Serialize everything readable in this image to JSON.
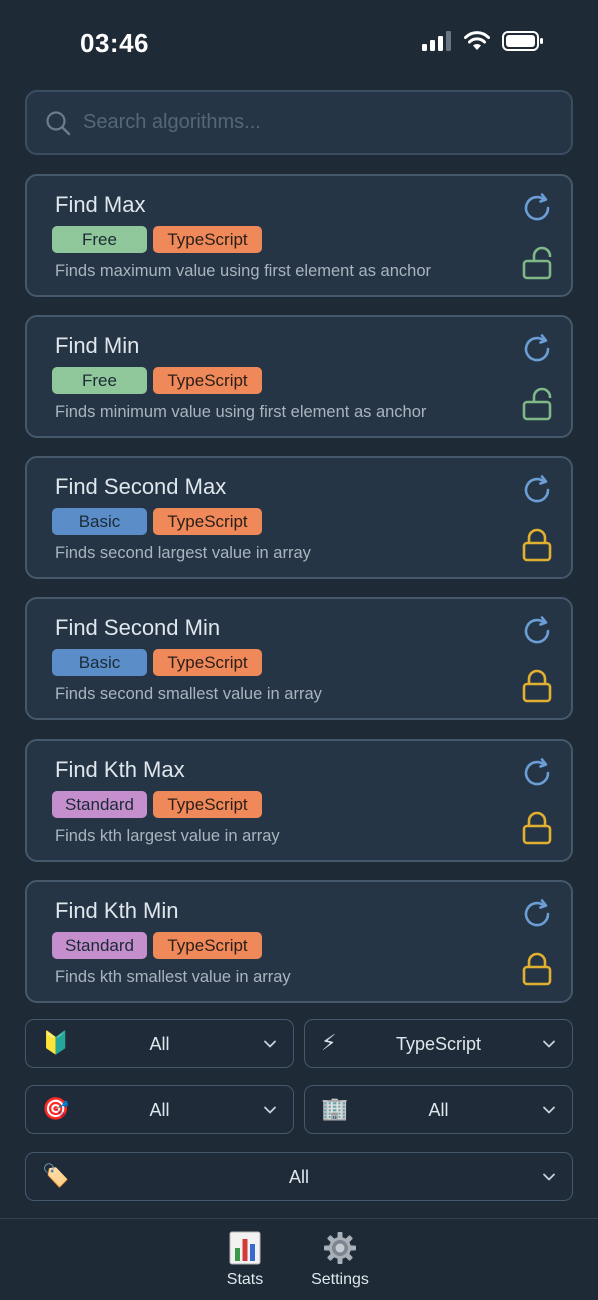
{
  "status": {
    "time": "03:46"
  },
  "search": {
    "placeholder": "Search algorithms..."
  },
  "colors": {
    "free": "#8fc79a",
    "basic": "#5b8ec9",
    "standard": "#c48fcc",
    "typescript": "#f0895a",
    "unlocked": "#7fb887",
    "locked": "#e0b030",
    "refresh": "#6a9ed4"
  },
  "algorithms": [
    {
      "title": "Find Max",
      "level": "Free",
      "language": "TypeScript",
      "description": "Finds maximum value using first element as anchor",
      "locked": false
    },
    {
      "title": "Find Min",
      "level": "Free",
      "language": "TypeScript",
      "description": "Finds minimum value using first element as anchor",
      "locked": false
    },
    {
      "title": "Find Second Max",
      "level": "Basic",
      "language": "TypeScript",
      "description": "Finds second largest value in array",
      "locked": true
    },
    {
      "title": "Find Second Min",
      "level": "Basic",
      "language": "TypeScript",
      "description": "Finds second smallest value in array",
      "locked": true
    },
    {
      "title": "Find Kth Max",
      "level": "Standard",
      "language": "TypeScript",
      "description": "Finds kth largest value in array",
      "locked": true
    },
    {
      "title": "Find Kth Min",
      "level": "Standard",
      "language": "TypeScript",
      "description": "Finds kth smallest value in array",
      "locked": true
    }
  ],
  "filters": [
    {
      "icon": "beginner-symbol-icon",
      "emoji": "🔰",
      "value": "All"
    },
    {
      "icon": "lightning-icon",
      "emoji": "⚡",
      "value": "TypeScript"
    },
    {
      "icon": "target-icon",
      "emoji": "🎯",
      "value": "All"
    },
    {
      "icon": "building-icon",
      "emoji": "🏢",
      "value": "All"
    },
    {
      "icon": "tag-icon",
      "emoji": "🏷️",
      "value": "All"
    }
  ],
  "tabs": [
    {
      "label": "Stats",
      "icon": "bar-chart-icon"
    },
    {
      "label": "Settings",
      "icon": "gear-icon"
    }
  ]
}
